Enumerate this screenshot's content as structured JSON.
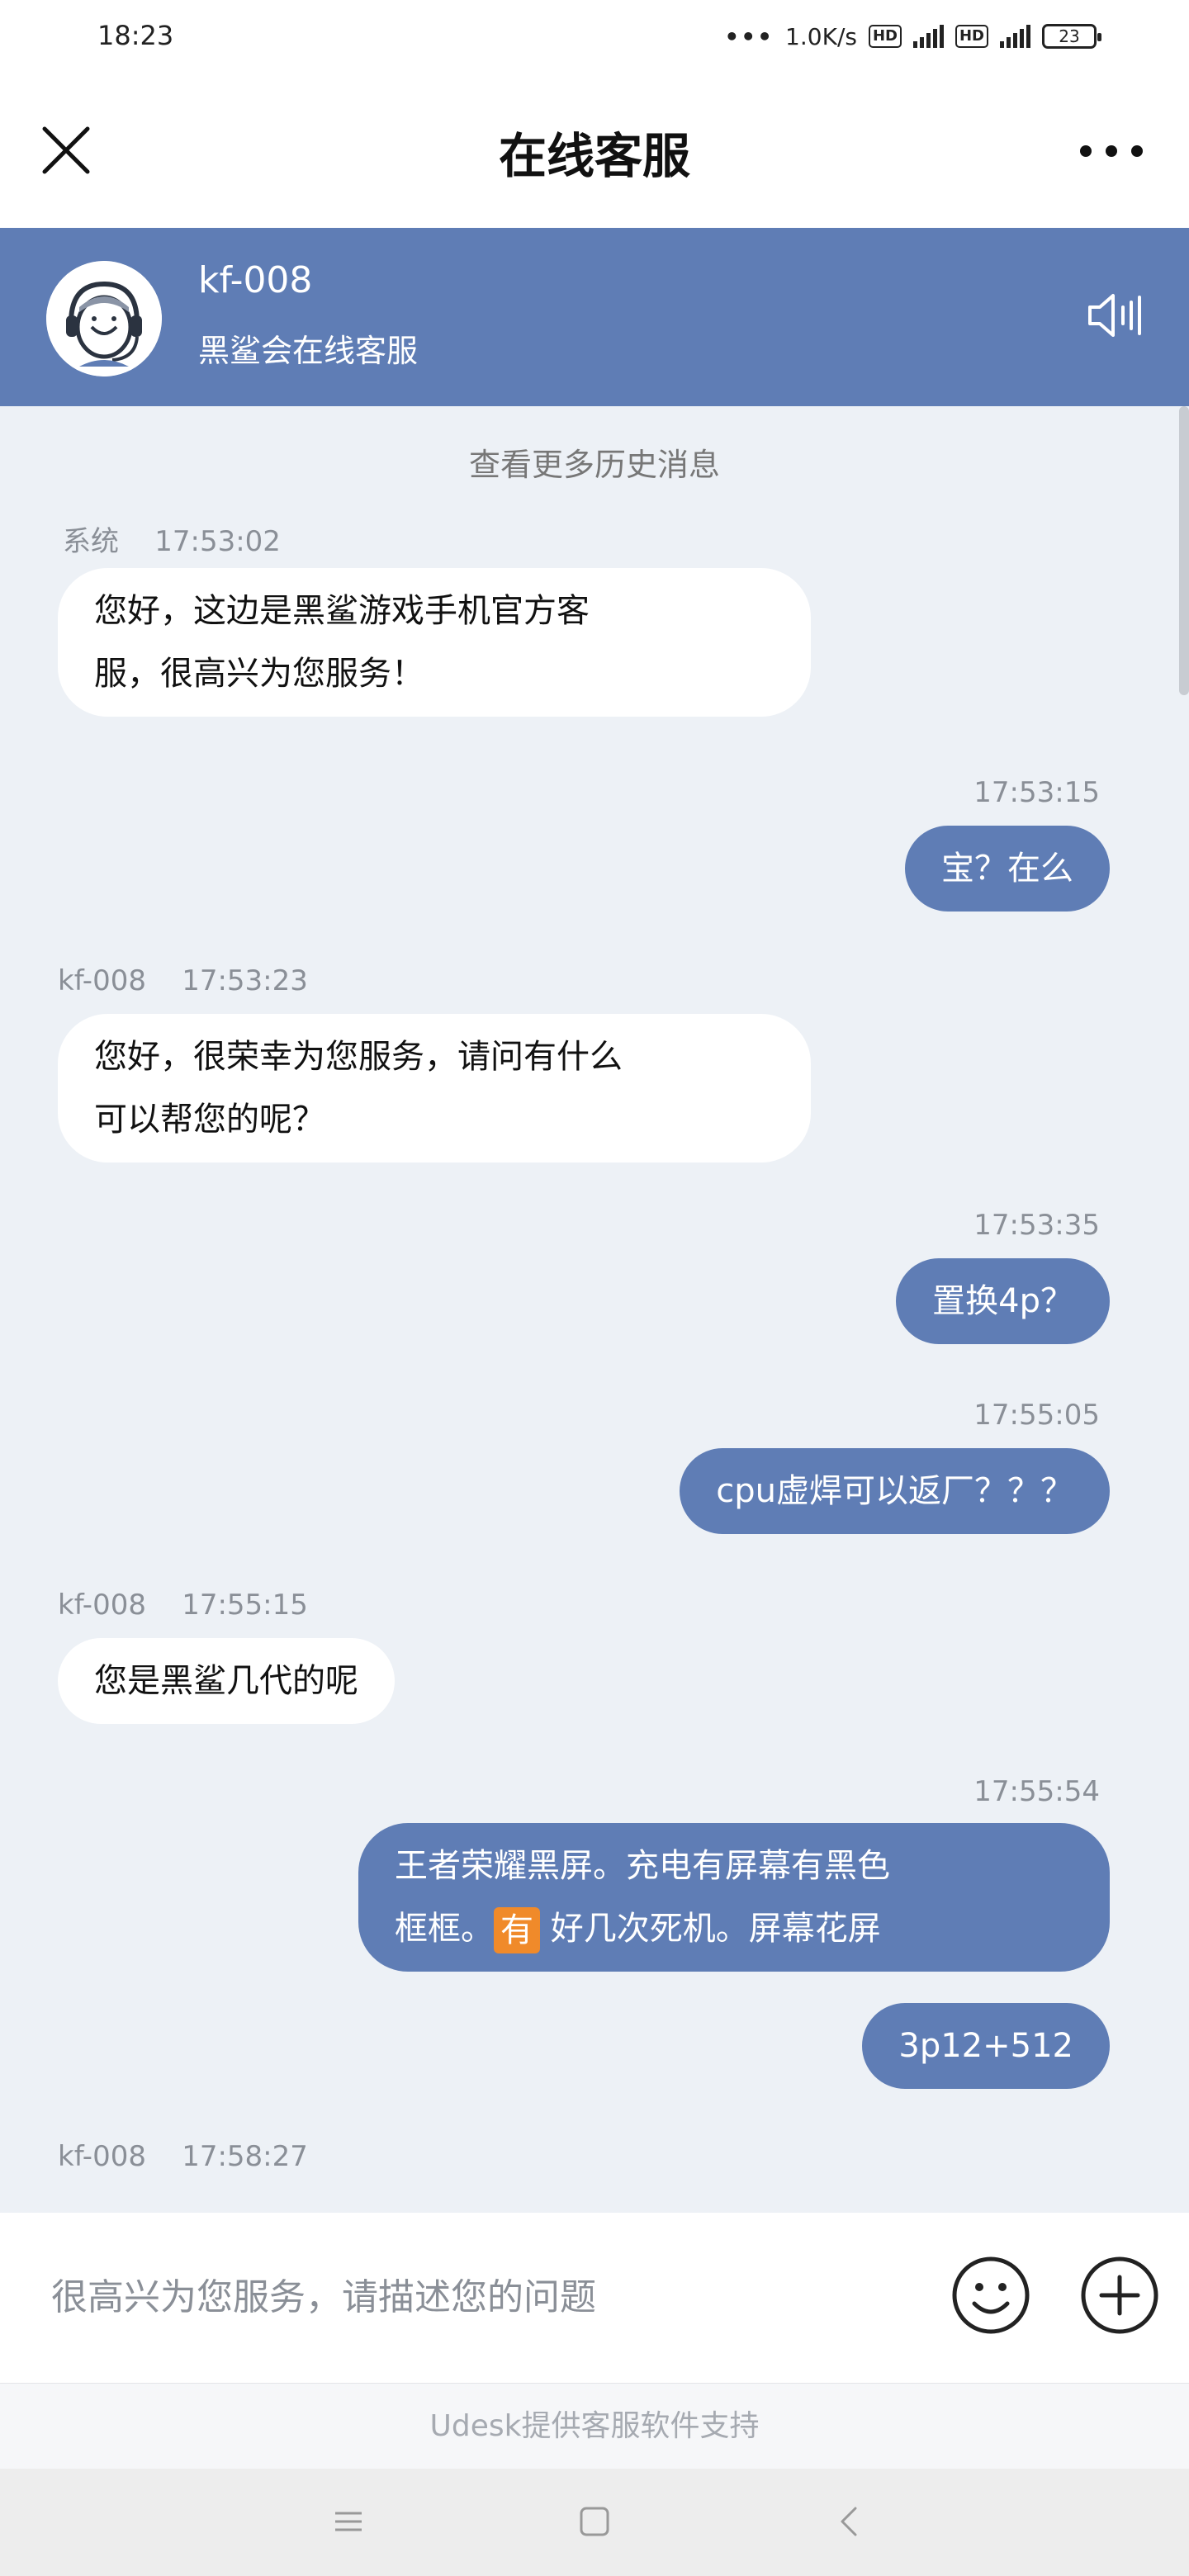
{
  "status_bar": {
    "time": "18:23",
    "net_speed": "1.0K/s",
    "hd1": "HD",
    "hd2": "HD",
    "battery": "23"
  },
  "header": {
    "title": "在线客服",
    "close_icon": "close-icon",
    "more_icon": "more-icon"
  },
  "agent": {
    "name": "kf-008",
    "subtitle": "黑鲨会在线客服",
    "avatar_icon": "agent-avatar",
    "speaker_icon": "speaker-icon"
  },
  "chat": {
    "history_link": "查看更多历史消息",
    "messages": [
      {
        "sender": "系统",
        "time": "17:53:02",
        "direction": "in",
        "lines": [
          "您好，这边是黑鲨游戏手机官方客",
          "服，很高兴为您服务！"
        ]
      },
      {
        "time": "17:53:15",
        "direction": "out",
        "lines": [
          "宝？在么"
        ]
      },
      {
        "sender": "kf-008",
        "time": "17:53:23",
        "direction": "in",
        "lines": [
          "您好，很荣幸为您服务，请问有什么",
          "可以帮您的呢？"
        ]
      },
      {
        "time": "17:53:35",
        "direction": "out",
        "lines": [
          "置换4p？"
        ]
      },
      {
        "time": "17:55:05",
        "direction": "out",
        "lines": [
          "cpu虚焊可以返厂？？？"
        ]
      },
      {
        "sender": "kf-008",
        "time": "17:55:15",
        "direction": "in",
        "lines": [
          "您是黑鲨几代的呢"
        ]
      },
      {
        "time": "17:55:54",
        "direction": "out",
        "lines": [
          "王者荣耀黑屏。充电有屏幕有黑色",
          "框框。",
          "有",
          " 好几次死机。屏幕花屏"
        ]
      },
      {
        "direction": "out",
        "lines": [
          "3p12+512"
        ]
      },
      {
        "sender": "kf-008",
        "time": "17:58:27",
        "direction": "in",
        "lines": []
      }
    ]
  },
  "input": {
    "placeholder": "很高兴为您服务，请描述您的问题",
    "emoji_icon": "smiley-icon",
    "plus_icon": "plus-icon"
  },
  "footer": {
    "powered_by": "Udesk提供客服软件支持"
  },
  "colors": {
    "brand": "#5f7db5",
    "background": "#edf1f6",
    "bubble_in": "#ffffff",
    "bubble_out": "#5f7db5"
  }
}
